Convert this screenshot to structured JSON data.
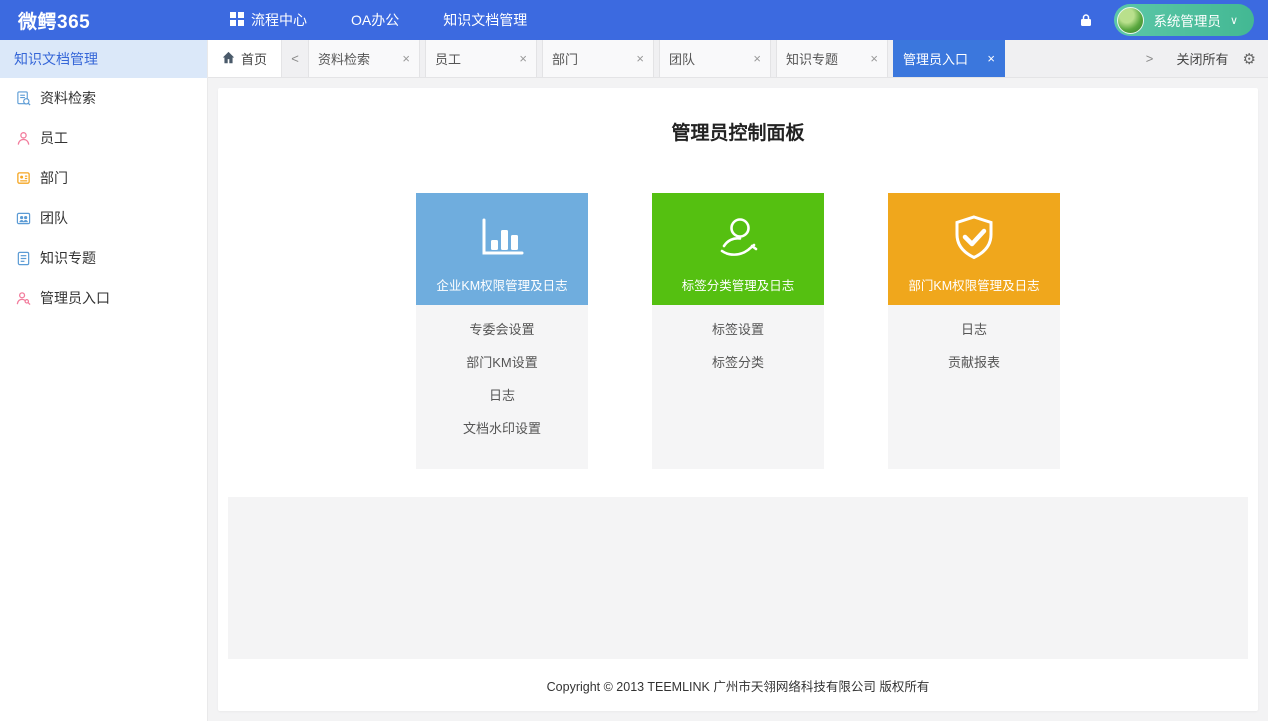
{
  "topbar": {
    "logo": "微鳄365",
    "nav": [
      {
        "label": "流程中心"
      },
      {
        "label": "OA办公"
      },
      {
        "label": "知识文档管理"
      }
    ],
    "user": {
      "name": "系统管理员",
      "dropdown_glyph": "∨"
    }
  },
  "sidebar": {
    "title": "知识文档管理",
    "items": [
      {
        "label": "资料检索"
      },
      {
        "label": "员工"
      },
      {
        "label": "部门"
      },
      {
        "label": "团队"
      },
      {
        "label": "知识专题"
      },
      {
        "label": "管理员入口"
      }
    ]
  },
  "tabbar": {
    "home": "首页",
    "scroll_left": "<",
    "scroll_right": ">",
    "close_glyph": "×",
    "close_all": "关闭所有",
    "gear_glyph": "⚙",
    "tabs": [
      {
        "label": "资料检索",
        "active": false
      },
      {
        "label": "员工",
        "active": false
      },
      {
        "label": "部门",
        "active": false
      },
      {
        "label": "团队",
        "active": false
      },
      {
        "label": "知识专题",
        "active": false
      },
      {
        "label": "管理员入口",
        "active": true
      }
    ]
  },
  "main": {
    "title": "管理员控制面板",
    "panels": [
      {
        "title": "企业KM权限管理及日志",
        "color": "#6fadde",
        "icon": "bar-chart-icon",
        "links": [
          "专委会设置",
          "部门KM设置",
          "日志",
          "文档水印设置"
        ]
      },
      {
        "title": "标签分类管理及日志",
        "color": "#55c011",
        "icon": "person-tag-icon",
        "links": [
          "标签设置",
          "标签分类"
        ]
      },
      {
        "title": "部门KM权限管理及日志",
        "color": "#f0a71c",
        "icon": "shield-check-icon",
        "links": [
          "日志",
          "贡献报表"
        ]
      }
    ],
    "footer": "Copyright © 2013 TEEMLINK 广州市天翎网络科技有限公司 版权所有"
  },
  "colors": {
    "topbar_blue": "#3c6ae0",
    "active_tab_blue": "#3b77dd",
    "user_pill_teal": "#4dbd9e",
    "sidebar_title_bg": "#dbe8f9",
    "panel_blue": "#6fadde",
    "panel_green": "#55c011",
    "panel_orange": "#f0a71c"
  }
}
